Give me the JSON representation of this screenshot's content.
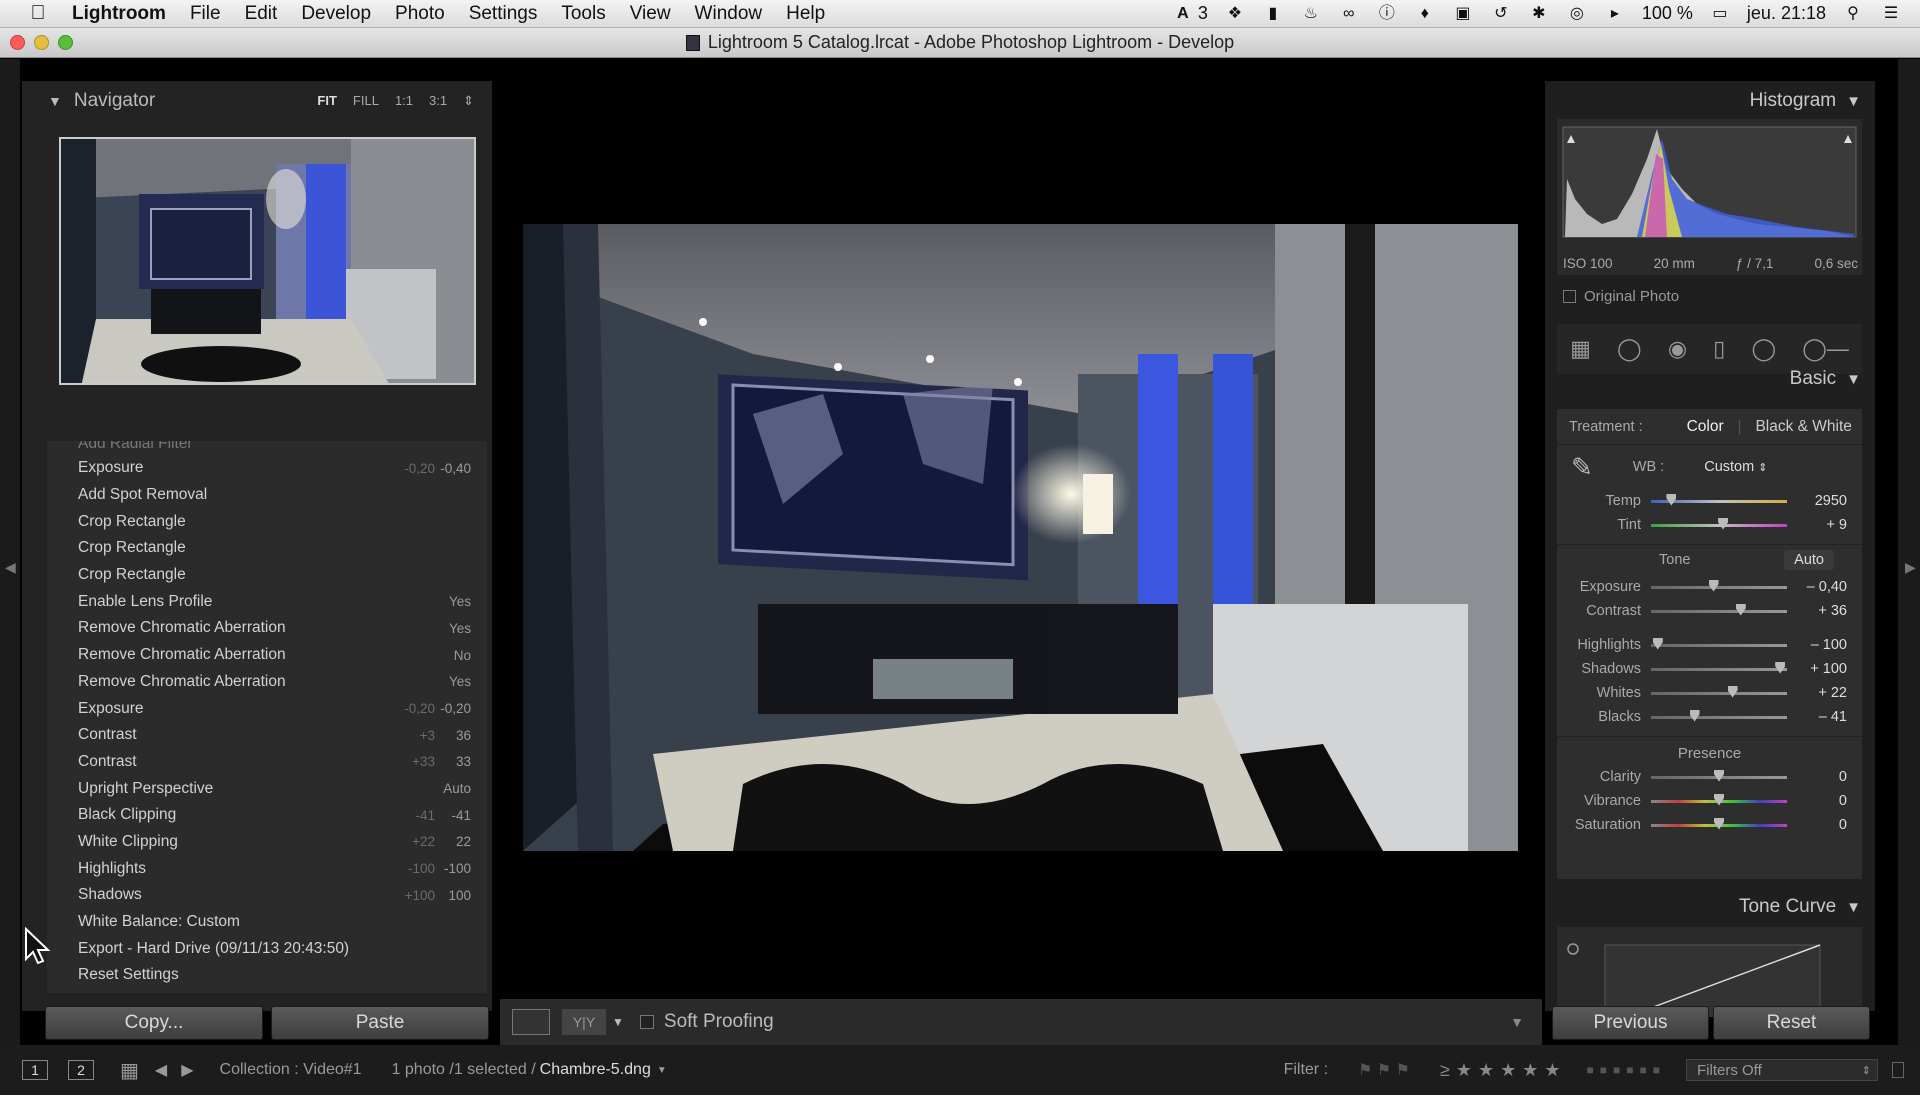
{
  "menubar": {
    "app": "Lightroom",
    "items": [
      "File",
      "Edit",
      "Develop",
      "Photo",
      "Settings",
      "Tools",
      "View",
      "Window",
      "Help"
    ],
    "status_badge": "3",
    "battery": "100 %",
    "clock": "jeu. 21:18"
  },
  "window": {
    "title": "Lightroom 5 Catalog.lrcat - Adobe Photoshop Lightroom - Develop"
  },
  "navigator": {
    "title": "Navigator",
    "zoom": [
      "FIT",
      "FILL",
      "1:1",
      "3:1"
    ],
    "selected_zoom": "FIT"
  },
  "history": {
    "partial_item": "Add Radial Filter",
    "items": [
      {
        "label": "Exposure",
        "before": "-0,20",
        "after": "-0,40"
      },
      {
        "label": "Add Spot Removal",
        "before": "",
        "after": ""
      },
      {
        "label": "Crop Rectangle",
        "before": "",
        "after": ""
      },
      {
        "label": "Crop Rectangle",
        "before": "",
        "after": ""
      },
      {
        "label": "Crop Rectangle",
        "before": "",
        "after": ""
      },
      {
        "label": "Enable Lens Profile",
        "before": "",
        "after": "Yes"
      },
      {
        "label": "Remove Chromatic Aberration",
        "before": "",
        "after": "Yes"
      },
      {
        "label": "Remove Chromatic Aberration",
        "before": "",
        "after": "No"
      },
      {
        "label": "Remove Chromatic Aberration",
        "before": "",
        "after": "Yes"
      },
      {
        "label": "Exposure",
        "before": "-0,20",
        "after": "-0,20"
      },
      {
        "label": "Contrast",
        "before": "+3",
        "after": "36"
      },
      {
        "label": "Contrast",
        "before": "+33",
        "after": "33"
      },
      {
        "label": "Upright Perspective",
        "before": "",
        "after": "Auto"
      },
      {
        "label": "Black Clipping",
        "before": "-41",
        "after": "-41"
      },
      {
        "label": "White Clipping",
        "before": "+22",
        "after": "22"
      },
      {
        "label": "Highlights",
        "before": "-100",
        "after": "-100"
      },
      {
        "label": "Shadows",
        "before": "+100",
        "after": "100"
      },
      {
        "label": "White Balance: Custom",
        "before": "",
        "after": ""
      },
      {
        "label": "Export - Hard Drive (09/11/13 20:43:50)",
        "before": "",
        "after": ""
      },
      {
        "label": "Reset Settings",
        "before": "",
        "after": ""
      }
    ]
  },
  "left_buttons": {
    "copy": "Copy...",
    "paste": "Paste"
  },
  "toolbar": {
    "soft_proofing": "Soft Proofing"
  },
  "histogram": {
    "title": "Histogram",
    "iso": "ISO 100",
    "focal": "20 mm",
    "aperture": "ƒ / 7,1",
    "shutter": "0,6 sec",
    "original_photo": "Original Photo"
  },
  "basic": {
    "title": "Basic",
    "treatment_label": "Treatment :",
    "color": "Color",
    "bw": "Black & White",
    "wb_label": "WB :",
    "wb_value": "Custom",
    "tone_label": "Tone",
    "auto": "Auto",
    "presence_label": "Presence",
    "wb_sliders": [
      {
        "label": "Temp",
        "value": "2950",
        "pos": 0.15
      },
      {
        "label": "Tint",
        "value": "+ 9",
        "pos": 0.53
      }
    ],
    "tone_sliders_a": [
      {
        "label": "Exposure",
        "value": "– 0,40",
        "pos": 0.46
      },
      {
        "label": "Contrast",
        "value": "+ 36",
        "pos": 0.66
      }
    ],
    "tone_sliders_b": [
      {
        "label": "Highlights",
        "value": "– 100",
        "pos": 0.05
      },
      {
        "label": "Shadows",
        "value": "+ 100",
        "pos": 0.95
      },
      {
        "label": "Whites",
        "value": "+ 22",
        "pos": 0.6
      },
      {
        "label": "Blacks",
        "value": "– 41",
        "pos": 0.32
      }
    ],
    "presence_sliders": [
      {
        "label": "Clarity",
        "value": "0",
        "pos": 0.5
      },
      {
        "label": "Vibrance",
        "value": "0",
        "pos": 0.5
      },
      {
        "label": "Saturation",
        "value": "0",
        "pos": 0.5
      }
    ]
  },
  "tone_curve": {
    "title": "Tone Curve"
  },
  "right_buttons": {
    "previous": "Previous",
    "reset": "Reset"
  },
  "filmstrip": {
    "screen1": "1",
    "screen2": "2",
    "collection": "Collection : Video#1",
    "selection": "1 photo /1 selected /",
    "filename": "Chambre-5.dng",
    "filter_label": "Filter :",
    "filters_off": "Filters Off"
  },
  "colors": {
    "accent_blue": "#3f5fd9",
    "panel": "#232323"
  }
}
